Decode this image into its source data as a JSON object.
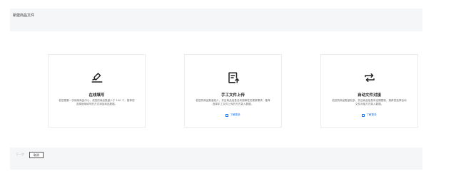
{
  "header": {
    "title": "新建商品文件"
  },
  "cards": [
    {
      "icon": "edit-pen-icon",
      "title": "在线填写",
      "description": "若您是第一次使用商品中心，或您的商品数量少于 100 个，推荐您选择使用填写的方式添加商品数据。",
      "link": ""
    },
    {
      "icon": "upload-file-icon",
      "title": "手工文件上传",
      "description": "若您的商品数量较少，并且商品信息没有规律性的更新需求，推荐选择手工文件上传的方式录入数据。",
      "link": "了解更多"
    },
    {
      "icon": "sync-arrows-icon",
      "title": "自动文件对接",
      "description": "若您的商品数量较多，并且商品信息有定期更新，推荐您选择自动文件对接方式录入数据。",
      "link": "了解更多"
    }
  ],
  "footer": {
    "next_label": "下一步",
    "cancel_label": "取消"
  },
  "colors": {
    "accent": "#1a73e8",
    "frame_bg": "#f5f6f8"
  }
}
